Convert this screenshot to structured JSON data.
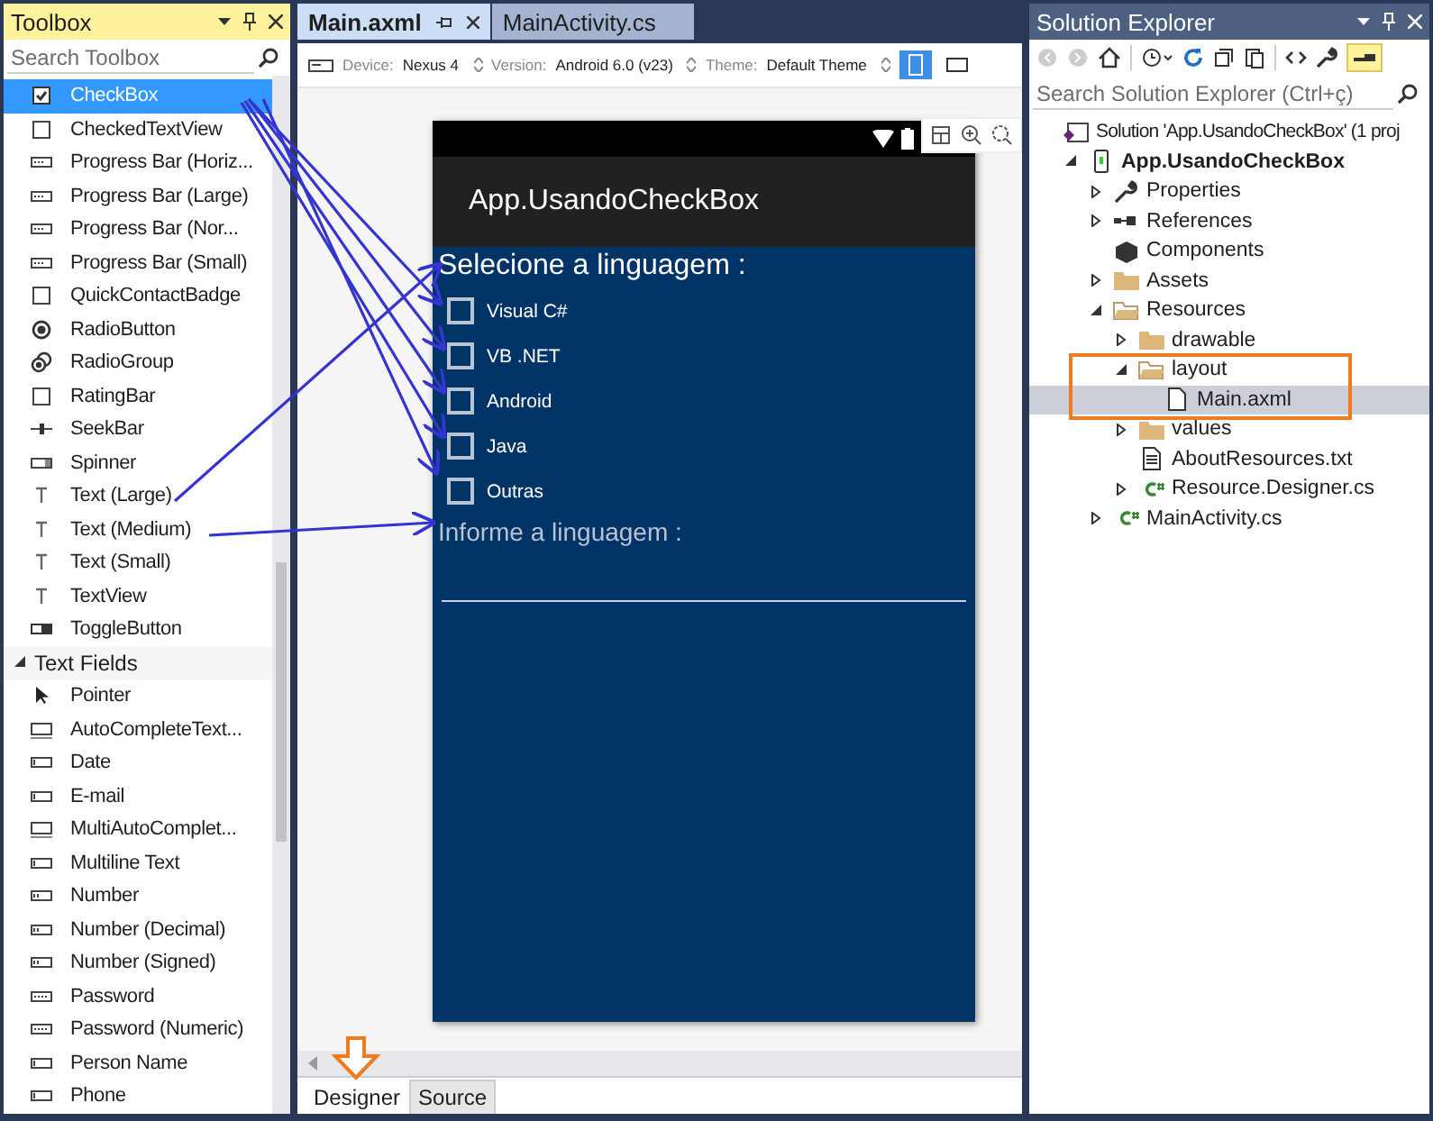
{
  "toolbox": {
    "title": "Toolbox",
    "search": {
      "placeholder": "Search Toolbox"
    },
    "items": [
      {
        "kind": "checkbox",
        "label": "CheckBox",
        "selected": true
      },
      {
        "kind": "square",
        "label": "CheckedTextView",
        "selected": false
      },
      {
        "kind": "bar",
        "label": "Progress Bar (Horiz...",
        "selected": false
      },
      {
        "kind": "bar",
        "label": "Progress Bar (Large)",
        "selected": false
      },
      {
        "kind": "bar",
        "label": "Progress Bar (Nor...",
        "selected": false
      },
      {
        "kind": "bar",
        "label": "Progress Bar (Small)",
        "selected": false
      },
      {
        "kind": "square",
        "label": "QuickContactBadge",
        "selected": false
      },
      {
        "kind": "radio",
        "label": "RadioButton",
        "selected": false
      },
      {
        "kind": "radiogroup",
        "label": "RadioGroup",
        "selected": false
      },
      {
        "kind": "square",
        "label": "RatingBar",
        "selected": false
      },
      {
        "kind": "seek",
        "label": "SeekBar",
        "selected": false
      },
      {
        "kind": "spinner",
        "label": "Spinner",
        "selected": false
      },
      {
        "kind": "text",
        "label": "Text (Large)",
        "selected": false
      },
      {
        "kind": "text",
        "label": "Text (Medium)",
        "selected": false
      },
      {
        "kind": "text",
        "label": "Text (Small)",
        "selected": false
      },
      {
        "kind": "text",
        "label": "TextView",
        "selected": false
      },
      {
        "kind": "toggle",
        "label": "ToggleButton",
        "selected": false
      },
      {
        "kind": "group",
        "label": "Text Fields",
        "expanded": true
      },
      {
        "kind": "pointer",
        "label": "Pointer",
        "selected": false
      },
      {
        "kind": "field2",
        "label": "AutoCompleteText...",
        "selected": false
      },
      {
        "kind": "field",
        "label": "Date",
        "selected": false
      },
      {
        "kind": "field",
        "label": "E-mail",
        "selected": false
      },
      {
        "kind": "field2",
        "label": "MultiAutoComplet...",
        "selected": false
      },
      {
        "kind": "field",
        "label": "Multiline Text",
        "selected": false
      },
      {
        "kind": "numfield",
        "label": "Number",
        "selected": false
      },
      {
        "kind": "numfield",
        "label": "Number (Decimal)",
        "selected": false
      },
      {
        "kind": "numfield",
        "label": "Number (Signed)",
        "selected": false
      },
      {
        "kind": "dotfield",
        "label": "Password",
        "selected": false
      },
      {
        "kind": "dotfield",
        "label": "Password (Numeric)",
        "selected": false
      },
      {
        "kind": "field",
        "label": "Person Name",
        "selected": false
      },
      {
        "kind": "field",
        "label": "Phone",
        "selected": false
      }
    ]
  },
  "designer": {
    "tabs": [
      {
        "label": "Main.axml",
        "selected": true
      },
      {
        "label": "MainActivity.cs",
        "selected": false
      }
    ],
    "settings": [
      {
        "label": "Device:",
        "value": "Nexus 4"
      },
      {
        "label": "Version:",
        "value": "Android 6.0 (v23)"
      },
      {
        "label": "Theme:",
        "value": "Default Theme"
      }
    ],
    "orientation": [
      {
        "kind": "portrait",
        "selected": true
      },
      {
        "kind": "landscape",
        "selected": false
      }
    ],
    "phone": {
      "app_title": "App.UsandoCheckBox",
      "heading": "Selecione a linguagem :",
      "options": [
        {
          "label": "Visual C#",
          "checked": false
        },
        {
          "label": "VB .NET",
          "checked": false
        },
        {
          "label": "Android",
          "checked": false
        },
        {
          "label": "Java",
          "checked": false
        },
        {
          "label": "Outras",
          "checked": false
        }
      ],
      "prompt": "Informe a linguagem :"
    },
    "bottom_tabs": [
      {
        "label": "Designer",
        "selected": true
      },
      {
        "label": "Source",
        "selected": false
      }
    ]
  },
  "solution_explorer": {
    "title": "Solution Explorer",
    "search": {
      "placeholder": "Search Solution Explorer (Ctrl+ç)"
    },
    "tree": [
      {
        "kind": "solution",
        "label": "Solution 'App.UsandoCheckBox' (1 proj",
        "selected": false,
        "children": [
          {
            "kind": "project",
            "label": "App.UsandoCheckBox",
            "expanded": true,
            "selected": false,
            "children": [
              {
                "kind": "wrench",
                "label": "Properties",
                "expanded": false,
                "selected": false
              },
              {
                "kind": "refs",
                "label": "References",
                "expanded": false,
                "selected": false
              },
              {
                "kind": "component",
                "label": "Components",
                "selected": false
              },
              {
                "kind": "folder",
                "label": "Assets",
                "expanded": false,
                "selected": false
              },
              {
                "kind": "openfolder",
                "label": "Resources",
                "expanded": true,
                "selected": false,
                "children": [
                  {
                    "kind": "folder",
                    "label": "drawable",
                    "expanded": false,
                    "selected": false
                  },
                  {
                    "kind": "openfolder",
                    "label": "layout",
                    "expanded": true,
                    "selected": false,
                    "children": [
                      {
                        "kind": "file",
                        "label": "Main.axml",
                        "selected": true
                      }
                    ]
                  },
                  {
                    "kind": "folder",
                    "label": "values",
                    "expanded": false,
                    "selected": false
                  },
                  {
                    "kind": "txt",
                    "label": "AboutResources.txt",
                    "selected": false
                  },
                  {
                    "kind": "cs",
                    "label": "Resource.Designer.cs",
                    "expanded": false,
                    "selected": false
                  }
                ]
              },
              {
                "kind": "cs",
                "label": "MainActivity.cs",
                "expanded": false,
                "selected": false
              }
            ]
          }
        ]
      }
    ]
  }
}
